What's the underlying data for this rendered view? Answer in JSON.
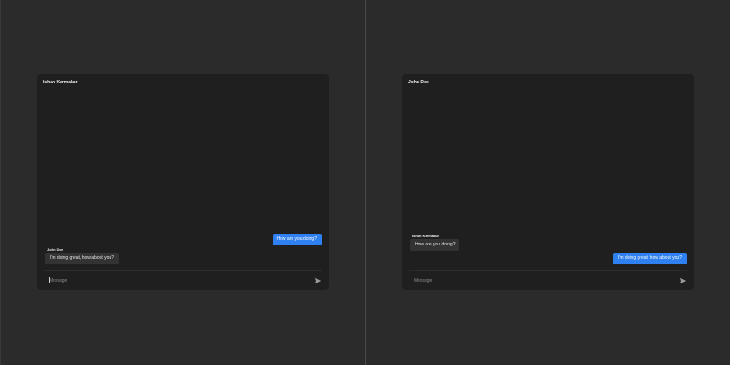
{
  "panes": [
    {
      "title": "Ishan Karmakar",
      "messages": [
        {
          "direction": "out",
          "text": "How are you doing?"
        },
        {
          "direction": "in",
          "sender": "John Doe",
          "text": "I'm doing great, how about you?"
        }
      ],
      "input": {
        "placeholder": "Message",
        "value": ""
      }
    },
    {
      "title": "John Doe",
      "messages": [
        {
          "direction": "in",
          "sender": "Ishan Karmakar",
          "text": "How are you doing?"
        },
        {
          "direction": "out",
          "text": "I'm doing great, how about you?"
        }
      ],
      "input": {
        "placeholder": "Message",
        "value": ""
      }
    }
  ],
  "icons": {
    "send": "send-icon"
  },
  "colors": {
    "outgoing_bubble": "#2f80f0",
    "incoming_bubble": "#333333",
    "window_bg": "#1f1f1f",
    "page_bg": "#2b2b2b"
  }
}
